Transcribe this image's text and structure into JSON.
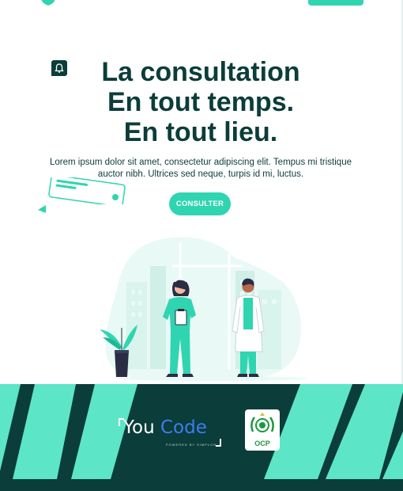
{
  "header": {
    "logo_icon": "shield-logo-icon",
    "cta_button": "cta-button"
  },
  "hero": {
    "title_lines": [
      "La consultation",
      "En tout temps.",
      "En tout lieu."
    ],
    "description": "Lorem ipsum dolor sit amet, consectetur adipiscing elit. Tempus mi tristique auctor nibh. Ultrices sed neque, turpis id mi, luctus.",
    "cta_label": "CONSULTER",
    "decorations": [
      "bell-icon",
      "card-illustration",
      "play-triangle-icon"
    ]
  },
  "footer": {
    "youcode": {
      "you": "You",
      "code": "Code",
      "tagline": "POWERED BY SIMPLON"
    },
    "ocp_label": "OCP"
  },
  "colors": {
    "primary": "#2fd5b0",
    "dark": "#0b3d3a",
    "stripe": "#5ce6c7",
    "code_blue": "#3e7cf2",
    "ocp_green": "#199a3e"
  }
}
